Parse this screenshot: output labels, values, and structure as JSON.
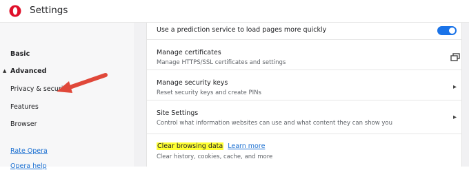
{
  "app": {
    "title": "Settings"
  },
  "sidebar": {
    "basic": "Basic",
    "advanced": "Advanced",
    "items": [
      "Privacy & security",
      "Features",
      "Browser"
    ],
    "rate_opera": "Rate Opera",
    "opera_help": "Opera help"
  },
  "settings": {
    "prediction": {
      "title": "Use a prediction service to load pages more quickly",
      "enabled": true
    },
    "certificates": {
      "title": "Manage certificates",
      "subtitle": "Manage HTTPS/SSL certificates and settings"
    },
    "security_keys": {
      "title": "Manage security keys",
      "subtitle": "Reset security keys and create PINs"
    },
    "site_settings": {
      "title": "Site Settings",
      "subtitle": "Control what information websites can use and what content they can show you"
    },
    "clear_data": {
      "title": "Clear browsing data",
      "learn_more": "Learn more",
      "subtitle": "Clear history, cookies, cache, and more"
    }
  },
  "colors": {
    "accent": "#1a73e8",
    "highlight": "#ffff33",
    "arrow": "#e0483a",
    "brand": "#e0112b"
  },
  "icons": [
    "opera-logo",
    "caret-up-icon",
    "external-link-icon",
    "chevron-right-icon",
    "red-arrow-annotation"
  ]
}
